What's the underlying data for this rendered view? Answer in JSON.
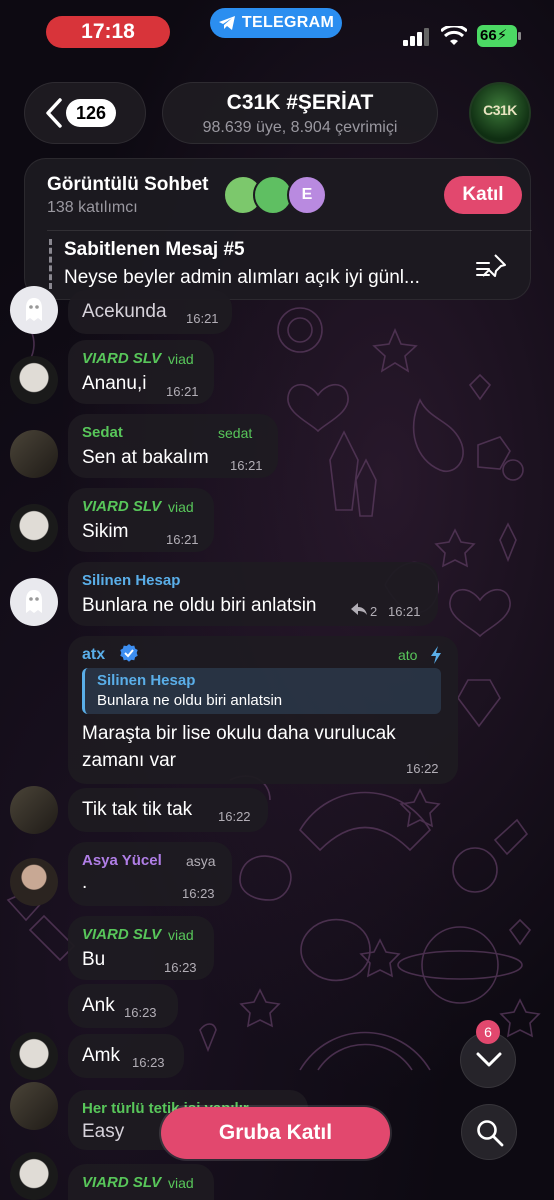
{
  "status_bar": {
    "time": "17:18",
    "app_pill": "TELEGRAM",
    "battery": "66"
  },
  "header": {
    "back_count": "126",
    "title": "C31K #ŞERİAT",
    "subtitle": "98.639 üye, 8.904 çevrimiçi",
    "avatar_text": "C31K"
  },
  "video_chat": {
    "title": "Görüntülü Sohbet",
    "participants": "138 katılımcı",
    "join_label": "Katıl",
    "avatar_letter": "E"
  },
  "pinned": {
    "title": "Sabitlenen Mesaj #5",
    "text": "Neyse beyler admin alımları açık iyi günl..."
  },
  "messages": [
    {
      "text": "Acekunda",
      "time": "16:21"
    },
    {
      "sender": "VIARD SLV",
      "role": "viad",
      "text": "Ananu,i",
      "time": "16:21"
    },
    {
      "sender": "Sedat",
      "role": "sedat",
      "text": "Sen at bakalım",
      "time": "16:21"
    },
    {
      "sender": "VIARD SLV",
      "role": "viad",
      "text": "Sikim",
      "time": "16:21"
    },
    {
      "sender": "Silinen Hesap",
      "text": "Bunlara ne oldu biri anlatsin",
      "replies": "2",
      "time": "16:21"
    },
    {
      "sender": "atx",
      "role": "ato",
      "quote_name": "Silinen Hesap",
      "quote_text": "Bunlara ne oldu biri anlatsin",
      "text_line1": "Maraşta bir lise okulu daha vurulucak",
      "text_line2": "zamanı var",
      "time": "16:22"
    },
    {
      "text": "Tik tak tik tak",
      "time": "16:22"
    },
    {
      "sender": "Asya Yücel",
      "role": "asya",
      "text": ".",
      "time": "16:23"
    },
    {
      "sender": "VIARD SLV",
      "role": "viad",
      "text": "Bu",
      "time": "16:23"
    },
    {
      "text": "Ank",
      "time": "16:23"
    },
    {
      "text": "Amk",
      "time": "16:23"
    },
    {
      "sender": "Her türlü tetik işi yapılır",
      "text": "Easy"
    },
    {
      "sender": "VIARD SLV",
      "role": "viad"
    }
  ],
  "bottom": {
    "join_group_label": "Gruba Katıl",
    "unread_count": "6"
  },
  "colors": {
    "accent": "#e2486e",
    "telegram_blue": "#2b8ef0",
    "name_green": "#58c65a",
    "name_blue": "#5aaee8",
    "name_purple": "#b07ee6"
  },
  "icons": [
    "back-chevron-icon",
    "telegram-icon",
    "signal-icon",
    "wifi-icon",
    "pin-icon",
    "ghost-icon",
    "reply-icon",
    "verified-icon",
    "bolt-icon",
    "chevron-down-icon",
    "search-icon"
  ]
}
